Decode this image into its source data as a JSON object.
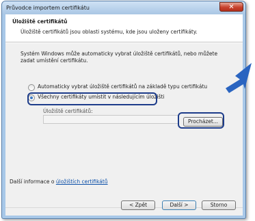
{
  "window": {
    "title": "Průvodce importem certifikátu",
    "close_label": "✕"
  },
  "header": {
    "title": "Úložiště certifikátů",
    "description": "Úložiště certifikátů jsou oblasti systému, kde jsou uloženy certifikáty."
  },
  "body": {
    "info": "Systém Windows může automaticky vybrat úložiště certifikátů, nebo můžete zadat umístění certifikátu.",
    "options": [
      {
        "label": "Automaticky vybrat úložiště certifikátů na základě typu certifikátu",
        "selected": false
      },
      {
        "label": "Všechny certifikáty umístit v následujícím úložišti",
        "selected": true
      }
    ],
    "store_label": "Úložiště certifikátů:",
    "store_value": "",
    "browse_label": "Procházet..."
  },
  "more_info": {
    "prefix": "Další informace o ",
    "link": "úložištích certifikátů"
  },
  "footer": {
    "back_label": "< Zpět",
    "next_label": "Další >",
    "cancel_label": "Storno"
  },
  "colors": {
    "highlight": "#1d3c8a",
    "arrow": "#2a64c0",
    "link": "#0b4fa8"
  },
  "annotation": {
    "icon": "pointer-arrow-icon"
  }
}
